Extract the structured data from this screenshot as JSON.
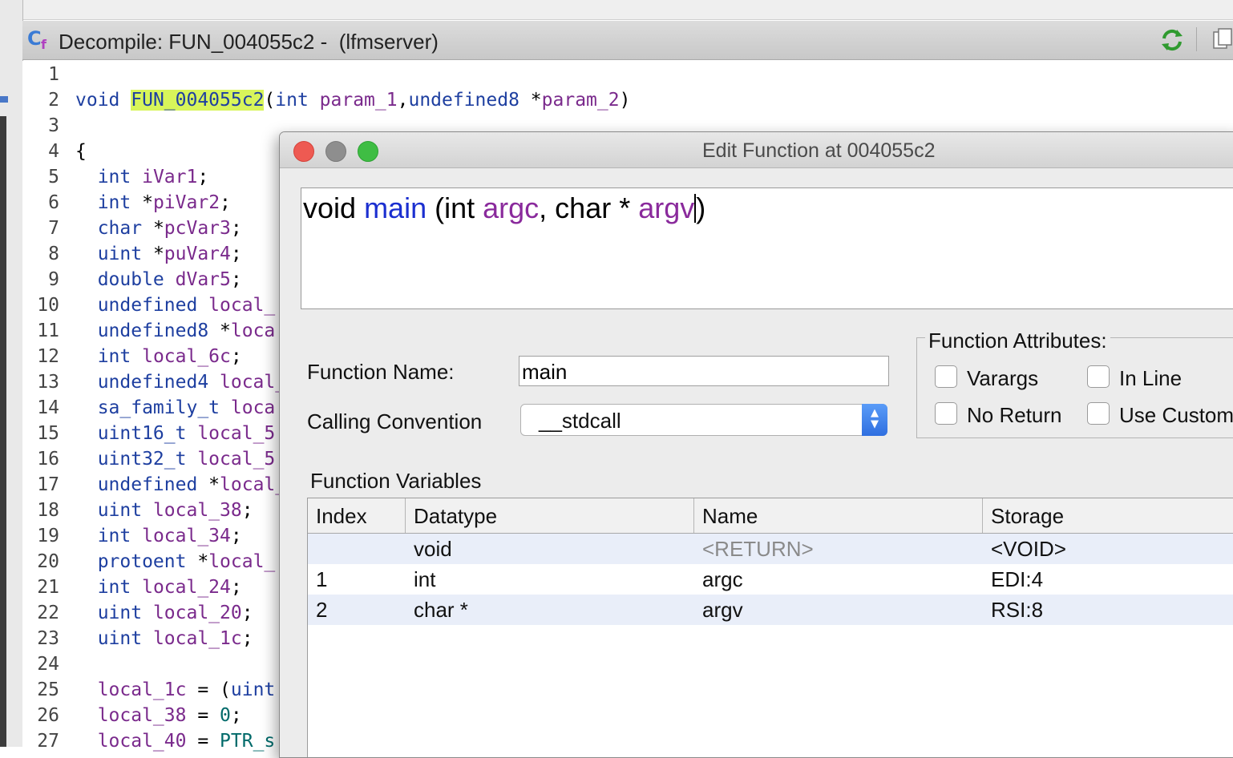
{
  "decompile": {
    "title": "Decompile: FUN_004055c2 -  (lfmserver)"
  },
  "code_lines": [
    {
      "n": "1",
      "t": []
    },
    {
      "n": "2",
      "t": [
        {
          "c": "kw",
          "s": "void "
        },
        {
          "c": "fn",
          "s": "FUN_004055c2"
        },
        {
          "c": "",
          "s": "("
        },
        {
          "c": "kw",
          "s": "int "
        },
        {
          "c": "var",
          "s": "param_1"
        },
        {
          "c": "",
          "s": ","
        },
        {
          "c": "kw",
          "s": "undefined8 "
        },
        {
          "c": "",
          "s": "*"
        },
        {
          "c": "var",
          "s": "param_2"
        },
        {
          "c": "",
          "s": ")"
        }
      ]
    },
    {
      "n": "3",
      "t": []
    },
    {
      "n": "4",
      "t": [
        {
          "c": "",
          "s": "{"
        }
      ]
    },
    {
      "n": "5",
      "t": [
        {
          "c": "kw",
          "s": "  int "
        },
        {
          "c": "var",
          "s": "iVar1"
        },
        {
          "c": "",
          "s": ";"
        }
      ]
    },
    {
      "n": "6",
      "t": [
        {
          "c": "kw",
          "s": "  int "
        },
        {
          "c": "",
          "s": "*"
        },
        {
          "c": "var",
          "s": "piVar2"
        },
        {
          "c": "",
          "s": ";"
        }
      ]
    },
    {
      "n": "7",
      "t": [
        {
          "c": "kw",
          "s": "  char "
        },
        {
          "c": "",
          "s": "*"
        },
        {
          "c": "var",
          "s": "pcVar3"
        },
        {
          "c": "",
          "s": ";"
        }
      ]
    },
    {
      "n": "8",
      "t": [
        {
          "c": "kw",
          "s": "  uint "
        },
        {
          "c": "",
          "s": "*"
        },
        {
          "c": "var",
          "s": "puVar4"
        },
        {
          "c": "",
          "s": ";"
        }
      ]
    },
    {
      "n": "9",
      "t": [
        {
          "c": "kw",
          "s": "  double "
        },
        {
          "c": "var",
          "s": "dVar5"
        },
        {
          "c": "",
          "s": ";"
        }
      ]
    },
    {
      "n": "10",
      "t": [
        {
          "c": "kw",
          "s": "  undefined "
        },
        {
          "c": "var",
          "s": "local_"
        }
      ]
    },
    {
      "n": "11",
      "t": [
        {
          "c": "kw",
          "s": "  undefined8 "
        },
        {
          "c": "",
          "s": "*"
        },
        {
          "c": "var",
          "s": "loca"
        }
      ]
    },
    {
      "n": "12",
      "t": [
        {
          "c": "kw",
          "s": "  int "
        },
        {
          "c": "var",
          "s": "local_6c"
        },
        {
          "c": "",
          "s": ";"
        }
      ]
    },
    {
      "n": "13",
      "t": [
        {
          "c": "kw",
          "s": "  undefined4 "
        },
        {
          "c": "var",
          "s": "local_"
        }
      ]
    },
    {
      "n": "14",
      "t": [
        {
          "c": "kw",
          "s": "  sa_family_t "
        },
        {
          "c": "var",
          "s": "loca"
        }
      ]
    },
    {
      "n": "15",
      "t": [
        {
          "c": "kw",
          "s": "  uint16_t "
        },
        {
          "c": "var",
          "s": "local_5"
        }
      ]
    },
    {
      "n": "16",
      "t": [
        {
          "c": "kw",
          "s": "  uint32_t "
        },
        {
          "c": "var",
          "s": "local_5"
        }
      ]
    },
    {
      "n": "17",
      "t": [
        {
          "c": "kw",
          "s": "  undefined "
        },
        {
          "c": "",
          "s": "*"
        },
        {
          "c": "var",
          "s": "local_"
        }
      ]
    },
    {
      "n": "18",
      "t": [
        {
          "c": "kw",
          "s": "  uint "
        },
        {
          "c": "var",
          "s": "local_38"
        },
        {
          "c": "",
          "s": ";"
        }
      ]
    },
    {
      "n": "19",
      "t": [
        {
          "c": "kw",
          "s": "  int "
        },
        {
          "c": "var",
          "s": "local_34"
        },
        {
          "c": "",
          "s": ";"
        }
      ]
    },
    {
      "n": "20",
      "t": [
        {
          "c": "kw",
          "s": "  protoent "
        },
        {
          "c": "",
          "s": "*"
        },
        {
          "c": "var",
          "s": "local_"
        }
      ]
    },
    {
      "n": "21",
      "t": [
        {
          "c": "kw",
          "s": "  int "
        },
        {
          "c": "var",
          "s": "local_24"
        },
        {
          "c": "",
          "s": ";"
        }
      ]
    },
    {
      "n": "22",
      "t": [
        {
          "c": "kw",
          "s": "  uint "
        },
        {
          "c": "var",
          "s": "local_20"
        },
        {
          "c": "",
          "s": ";"
        }
      ]
    },
    {
      "n": "23",
      "t": [
        {
          "c": "kw",
          "s": "  uint "
        },
        {
          "c": "var",
          "s": "local_1c"
        },
        {
          "c": "",
          "s": ";"
        }
      ]
    },
    {
      "n": "24",
      "t": []
    },
    {
      "n": "25",
      "t": [
        {
          "c": "var",
          "s": "  local_1c"
        },
        {
          "c": "",
          "s": " = ("
        },
        {
          "c": "kw",
          "s": "uint"
        }
      ]
    },
    {
      "n": "26",
      "t": [
        {
          "c": "var",
          "s": "  local_38"
        },
        {
          "c": "",
          "s": " = "
        },
        {
          "c": "num",
          "s": "0"
        },
        {
          "c": "",
          "s": ";"
        }
      ]
    },
    {
      "n": "27",
      "t": [
        {
          "c": "var",
          "s": "  local_40"
        },
        {
          "c": "",
          "s": " = "
        },
        {
          "c": "num",
          "s": "PTR_s"
        }
      ]
    }
  ],
  "dialog": {
    "title": "Edit Function at 004055c2",
    "signature": {
      "ret": "void",
      "name": "main",
      "open": "(int",
      "p1": "argc",
      "mid": ", char *",
      "p2": "argv",
      "close": ")"
    },
    "function_name_label": "Function Name:",
    "function_name_value": "main",
    "calling_convention_label": "Calling Convention",
    "calling_convention_value": "__stdcall",
    "attributes_legend": "Function Attributes:",
    "attributes": {
      "varargs": "Varargs",
      "inline": "In Line",
      "noreturn": "No Return",
      "custom": "Use Custom"
    },
    "variables_label": "Function Variables",
    "table": {
      "headers": [
        "Index",
        "Datatype",
        "Name",
        "Storage"
      ],
      "rows": [
        [
          "",
          "void",
          "<RETURN>",
          "<VOID>"
        ],
        [
          "1",
          "int",
          "argc",
          "EDI:4"
        ],
        [
          "2",
          "char *",
          "argv",
          "RSI:8"
        ]
      ]
    }
  }
}
